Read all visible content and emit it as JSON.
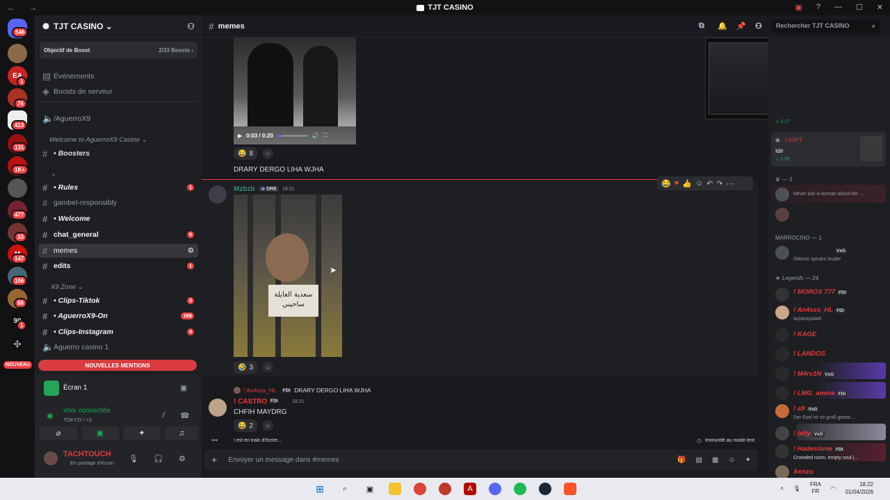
{
  "window": {
    "title": "TJT CASINO",
    "nav": "← →"
  },
  "guilds": [
    {
      "label": "546",
      "color": "#5865f2"
    },
    {
      "label": "",
      "color": "#8a6a4a"
    },
    {
      "label": "1",
      "color": "#c22"
    },
    {
      "label": "76",
      "color": "#a32"
    },
    {
      "label": "413",
      "color": "#fff"
    },
    {
      "label": "131",
      "color": "#911"
    },
    {
      "label": "1K+",
      "color": "#b11"
    },
    {
      "label": "",
      "color": "#555"
    },
    {
      "label": "477",
      "color": "#723"
    },
    {
      "label": "33",
      "color": "#733"
    },
    {
      "label": "147",
      "color": "#c11"
    },
    {
      "label": "106",
      "color": "#467"
    },
    {
      "label": "88",
      "color": "#963"
    },
    {
      "label": "1",
      "color": "#ddd"
    }
  ],
  "guild_labels": {
    "ea": "EA",
    "ninety": "90",
    "new": "NOUVEAU"
  },
  "server": {
    "name": "TJT CASINO ⌄",
    "boost_goal": "Objectif de Boost",
    "boost_count": "2/33 Boosts ›"
  },
  "sidebar": {
    "events": "Événements",
    "boosts": "Boosts de serveur",
    "voice_top": "/AguerroX9",
    "cat1": "Welcome to AguerroX9 Casino ⌄",
    "boosters": "• Boosters",
    "cat2": "⌄",
    "rules": "• Rules",
    "rules_count": "1",
    "gamble": "gambel-responsibly",
    "welcome": "• Welcome",
    "chat_general": "chat_general",
    "chat_count": "9",
    "memes": "memes",
    "edits": "edits",
    "edits_count": "1",
    "cat3": "X9 Zone ⌄",
    "clips_tiktok": "• Clips-Tiktok",
    "tiktok_count": "3",
    "aguerro_on": "• AguerroX9-On",
    "on_count": "186",
    "clips_insta": "• Clips-Instagram",
    "insta_count": "4",
    "voice_casino": "Aguerro casino 1",
    "new_mentions": "NOUVELLES MENTIONS"
  },
  "screen": {
    "label": "Écran 1",
    "voice": "Voix connectée",
    "voice_sub": "TOKYO / <3",
    "user": "TACHTOUCH",
    "user_status": "En partage d'écran"
  },
  "channel": {
    "name": "memes",
    "search": "Rechercher TJT CASINO"
  },
  "messages": {
    "video_time": "0:03 / 0:20",
    "react1_count": "8",
    "text1": "DRARY DERGO LIHA WJHA",
    "author2": "Mzbzb",
    "author2_tag": "DRE",
    "time2": "18:21",
    "sign_text": "سعدية العايلة ساحيني",
    "react2_count": "3",
    "reply_author": "! An4sss_HL",
    "reply_tag": "FDI",
    "reply_text": "DRARY DERGO LIHA WJHA",
    "author3": "! CASTRO",
    "author3_tag": "FDI",
    "time3": "18:21",
    "text3": "CHFIH MAYDRG",
    "react3_count": "2",
    "typing": "! est en train d'écrire...",
    "slowmode": "Immunité au mode lent",
    "input_placeholder": "Envoyer un message dans #memes"
  },
  "members_panel": {
    "light_name": "LIGHT",
    "light_status": "Idir",
    "light_time": "♫ 1:30",
    "stream_time": "♫ 2:17",
    "section_a": "— 2",
    "a1_status": "Never ask a woman about her ...",
    "section_b": "MARROCINO — 1",
    "b1_tag": "VxG",
    "b1_status": "Silence speaks louder",
    "section_c": "Legends — 24",
    "members": [
      {
        "name": "! MOROX 777",
        "tag": "FDI",
        "status": ""
      },
      {
        "name": "! An4sss_HL",
        "tag": "FDI",
        "status": "laylahaylalah"
      },
      {
        "name": "! KAGE",
        "tag": "",
        "status": ""
      },
      {
        "name": "! LANDOS",
        "tag": "",
        "status": ""
      },
      {
        "name": "! M4rv1N",
        "tag": "VxG",
        "status": ""
      },
      {
        "name": "! LMG_amine",
        "tag": "FDI",
        "status": ""
      },
      {
        "name": "! a9",
        "tag": "VxG",
        "status": "Der Esel ist so groß gewor..."
      },
      {
        "name": "! billy",
        "tag": "VxG",
        "status": ""
      },
      {
        "name": "! Hadesisme",
        "tag": "FDI",
        "status": "Crowded room, empty soul |..."
      },
      {
        "name": "Aenzo",
        "tag": "",
        "status": ""
      }
    ]
  },
  "taskbar": {
    "lang": "FRA",
    "lang2": "FR",
    "time": "18:22",
    "date": "01/04/2026"
  }
}
